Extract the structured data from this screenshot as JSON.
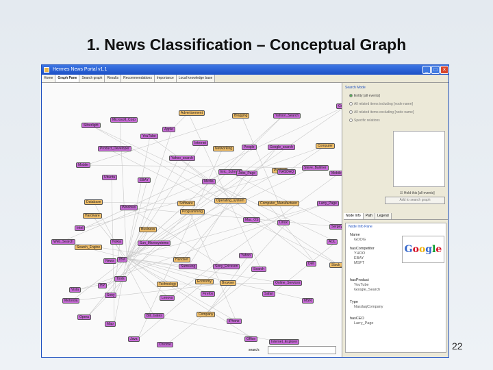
{
  "slide": {
    "title": "1. News Classification – Conceptual Graph",
    "page_number": "22"
  },
  "window": {
    "title": "Hermes News Portal v1.1",
    "buttons": [
      "_",
      "□",
      "×"
    ]
  },
  "tabs": [
    {
      "label": "Home"
    },
    {
      "label": "Graph Pane",
      "active": true
    },
    {
      "label": "Search graph"
    },
    {
      "label": "Results"
    },
    {
      "label": "Recommendations"
    },
    {
      "label": "Importance"
    },
    {
      "label": "Local knowledge base"
    }
  ],
  "graph": {
    "nodes": [
      {
        "label": "Microsoft_Corp",
        "color": "purple"
      },
      {
        "label": "Advertisement",
        "color": "orange"
      },
      {
        "label": "Blogging",
        "color": "orange"
      },
      {
        "label": "Yahoo!_Search",
        "color": "purple"
      },
      {
        "label": "Silverlight",
        "color": "purple"
      },
      {
        "label": "Google",
        "color": "purple"
      },
      {
        "label": "YouTube",
        "color": "purple"
      },
      {
        "label": "Apple",
        "color": "purple"
      },
      {
        "label": "Product_Developer",
        "color": "purple"
      },
      {
        "label": "Internet",
        "color": "purple"
      },
      {
        "label": "Networking",
        "color": "orange"
      },
      {
        "label": "People",
        "color": "purple"
      },
      {
        "label": "Google_search",
        "color": "purple"
      },
      {
        "label": "Computer",
        "color": "orange"
      },
      {
        "label": "Mobile",
        "color": "purple"
      },
      {
        "label": "Yahoo_search",
        "color": "purple"
      },
      {
        "label": "Eric_Schmidt",
        "color": "purple"
      },
      {
        "label": "Jobs_Page",
        "color": "purple"
      },
      {
        "label": "Product",
        "color": "orange"
      },
      {
        "label": "Mobile_phones",
        "color": "purple"
      },
      {
        "label": "Ubuntu",
        "color": "purple"
      },
      {
        "label": "EBAY",
        "color": "purple"
      },
      {
        "label": "Media",
        "color": "purple"
      },
      {
        "label": "NASDAQ",
        "color": "purple"
      },
      {
        "label": "Steve_Ballmer",
        "color": "purple"
      },
      {
        "label": "Database",
        "color": "orange"
      },
      {
        "label": "Windows",
        "color": "purple"
      },
      {
        "label": "Software",
        "color": "orange"
      },
      {
        "label": "Operating_system",
        "color": "orange"
      },
      {
        "label": "Computer_Manufacturer",
        "color": "orange"
      },
      {
        "label": "Hardware",
        "color": "orange"
      },
      {
        "label": "Programming",
        "color": "orange"
      },
      {
        "label": "Linux",
        "color": "purple"
      },
      {
        "label": "Larry_Page",
        "color": "purple"
      },
      {
        "label": "Sergey_Brin",
        "color": "purple"
      },
      {
        "label": "Intel",
        "color": "purple"
      },
      {
        "label": "Business",
        "color": "orange"
      },
      {
        "label": "Mac_OS",
        "color": "purple"
      },
      {
        "label": "Web_Search",
        "color": "purple"
      },
      {
        "label": "Search_Engine",
        "color": "orange"
      },
      {
        "label": "Nokia",
        "color": "purple"
      },
      {
        "label": "Sun_Microsystems",
        "color": "purple"
      },
      {
        "label": "News",
        "color": "purple"
      },
      {
        "label": "IBM",
        "color": "purple"
      },
      {
        "label": "Handset",
        "color": "orange"
      },
      {
        "label": "Samsung",
        "color": "purple"
      },
      {
        "label": "Sony_Ericsson",
        "color": "purple"
      },
      {
        "label": "Vista",
        "color": "purple"
      },
      {
        "label": "HP",
        "color": "purple"
      },
      {
        "label": "Tools",
        "color": "purple"
      },
      {
        "label": "Technology",
        "color": "orange"
      },
      {
        "label": "Economy",
        "color": "orange"
      },
      {
        "label": "Yahoo",
        "color": "purple"
      },
      {
        "label": "Search",
        "color": "purple"
      },
      {
        "label": "Online_Services",
        "color": "purple"
      },
      {
        "label": "Dell",
        "color": "purple"
      },
      {
        "label": "Stock_Exchange",
        "color": "orange"
      },
      {
        "label": "Motorola",
        "color": "purple"
      },
      {
        "label": "Sony",
        "color": "purple"
      },
      {
        "label": "Lenovo",
        "color": "purple"
      },
      {
        "label": "Firefox",
        "color": "purple"
      },
      {
        "label": "Browser",
        "color": "orange"
      },
      {
        "label": "Safari",
        "color": "purple"
      },
      {
        "label": "MSN",
        "color": "purple"
      },
      {
        "label": "AOL",
        "color": "purple"
      },
      {
        "label": "Opera",
        "color": "purple"
      },
      {
        "label": "Map",
        "color": "purple"
      },
      {
        "label": "Bill_Gates",
        "color": "purple"
      },
      {
        "label": "Company",
        "color": "orange"
      },
      {
        "label": "iPhone",
        "color": "purple"
      },
      {
        "label": "Java",
        "color": "purple"
      },
      {
        "label": "Chrome",
        "color": "purple"
      },
      {
        "label": "Office",
        "color": "purple"
      },
      {
        "label": "Internet_Explorer",
        "color": "purple"
      }
    ]
  },
  "search": {
    "label": "search: ",
    "value": ""
  },
  "right_panel": {
    "group_title": "Search Mode",
    "radios": [
      "Entity [all events]",
      "All related items including [node name]",
      "All related items excluding [node name]",
      "Specific relations"
    ],
    "checkbox": "Hold this [all events]",
    "add_button": "Add to search graph",
    "info_tabs": [
      "Node Info",
      "Path",
      "Legend"
    ],
    "info_page": {
      "title": "Node Info Pane",
      "props": [
        {
          "key": "Name",
          "value": "GOOG"
        },
        {
          "key": "hasCompetitor",
          "values": [
            "YHOO",
            "EBAY",
            "MSFT"
          ]
        },
        {
          "key": "hasProduct",
          "values": [
            "YouTube",
            "Google_Search"
          ]
        },
        {
          "key": "Type",
          "value": "NasdaqCompany"
        },
        {
          "key": "hasCEO",
          "value": "Larry_Page"
        }
      ],
      "logo": "Google",
      "logo_colors": [
        "#3366cc",
        "#d50f25",
        "#eeb211",
        "#3366cc",
        "#009925",
        "#d50f25"
      ]
    }
  }
}
